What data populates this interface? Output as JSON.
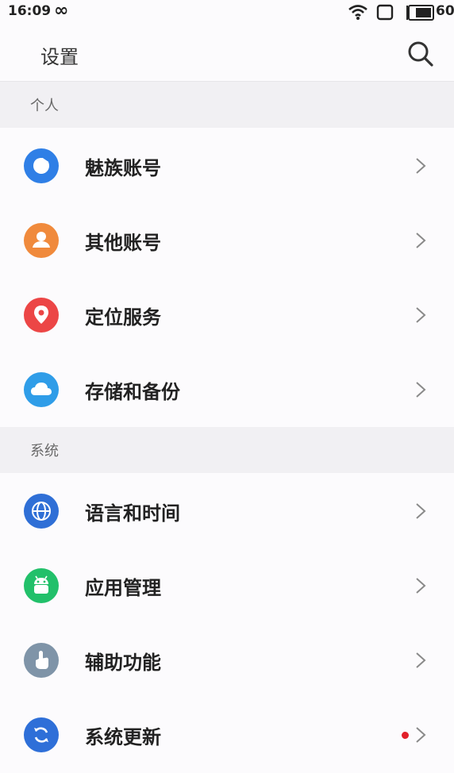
{
  "status_bar": {
    "time": "16:09",
    "battery_text": "60"
  },
  "header": {
    "title": "设置"
  },
  "sections": [
    {
      "label": "个人"
    },
    {
      "label": "系统"
    }
  ],
  "items": [
    {
      "label": "魅族账号",
      "icon": "meizu-account-icon",
      "color": "#2f7fe6"
    },
    {
      "label": "其他账号",
      "icon": "person-icon",
      "color": "#f08a3c"
    },
    {
      "label": "定位服务",
      "icon": "location-pin-icon",
      "color": "#ec4646"
    },
    {
      "label": "存储和备份",
      "icon": "cloud-icon",
      "color": "#2f9de8"
    },
    {
      "label": "语言和时间",
      "icon": "globe-icon",
      "color": "#2f6fd6"
    },
    {
      "label": "应用管理",
      "icon": "android-icon",
      "color": "#22c06a"
    },
    {
      "label": "辅助功能",
      "icon": "hand-pointer-icon",
      "color": "#7f94a8"
    },
    {
      "label": "系统更新",
      "icon": "refresh-icon",
      "color": "#2e6fd8",
      "badge": true
    }
  ]
}
